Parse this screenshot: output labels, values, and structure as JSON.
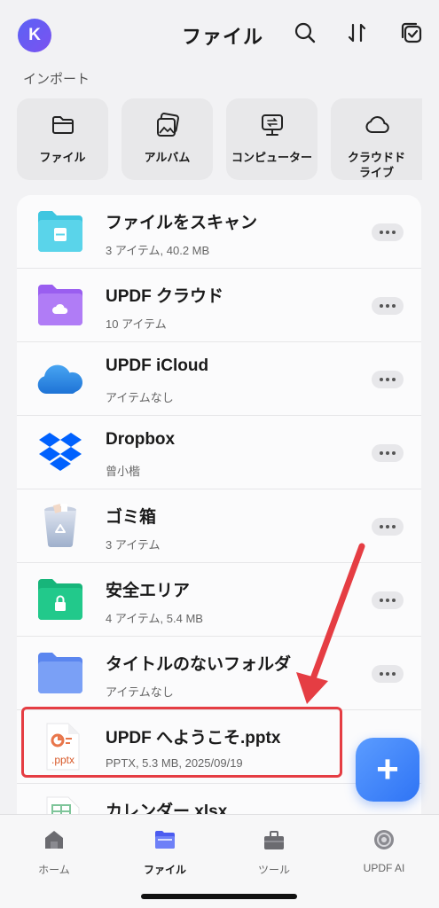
{
  "header": {
    "avatar_letter": "K",
    "title": "ファイル",
    "icons": [
      "search-icon",
      "sort-icon",
      "select-icon"
    ]
  },
  "import": {
    "section_label": "インポート",
    "tiles": [
      {
        "label": "ファイル",
        "icon": "folder-icon"
      },
      {
        "label": "アルバム",
        "icon": "album-icon"
      },
      {
        "label": "コンピューター",
        "icon": "computer-icon"
      },
      {
        "label": "クラウドドライブ",
        "icon": "cloud-icon"
      }
    ]
  },
  "files": [
    {
      "name": "ファイルをスキャン",
      "meta": "3 アイテム, 40.2 MB",
      "icon": "scan-folder-icon"
    },
    {
      "name": "UPDF クラウド",
      "meta": "10 アイテム",
      "icon": "updf-cloud-folder-icon"
    },
    {
      "name": "UPDF iCloud",
      "meta": "アイテムなし",
      "icon": "icloud-icon"
    },
    {
      "name": "Dropbox",
      "meta": "曾小楷",
      "icon": "dropbox-icon"
    },
    {
      "name": "ゴミ箱",
      "meta": "3 アイテム",
      "icon": "trash-icon"
    },
    {
      "name": "安全エリア",
      "meta": "4 アイテム, 5.4 MB",
      "icon": "secure-folder-icon"
    },
    {
      "name": "タイトルのないフォルダ",
      "meta": "アイテムなし",
      "icon": "folder-icon"
    },
    {
      "name": "UPDF へようこそ.pptx",
      "meta": "PPTX, 5.3 MB, 2025/09/19",
      "icon": "pptx-file-icon",
      "badge": ".pptx"
    },
    {
      "name": "カレンダー.xlsx",
      "meta": "",
      "icon": "xlsx-file-icon"
    }
  ],
  "fab_label": "+",
  "tabbar": [
    {
      "label": "ホーム",
      "icon": "home-icon"
    },
    {
      "label": "ファイル",
      "icon": "files-icon"
    },
    {
      "label": "ツール",
      "icon": "tools-icon"
    },
    {
      "label": "UPDF AI",
      "icon": "ai-icon"
    }
  ],
  "colors": {
    "accent": "#2f74f5",
    "highlight": "#e53d43",
    "avatar": "#5b62f5"
  }
}
